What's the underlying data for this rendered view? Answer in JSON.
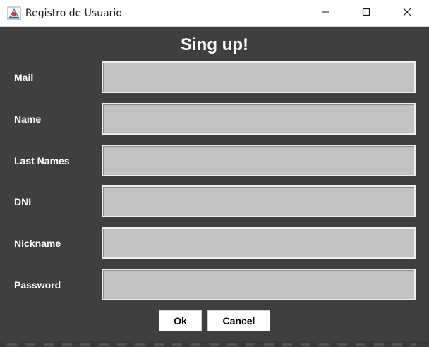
{
  "window": {
    "title": "Registro de Usuario",
    "icon": "java-app-icon",
    "controls": {
      "minimize_icon": "minimize-icon",
      "maximize_icon": "maximize-icon",
      "close_icon": "close-icon"
    }
  },
  "form": {
    "heading": "Sing up!",
    "fields": [
      {
        "label": "Mail",
        "value": ""
      },
      {
        "label": "Name",
        "value": ""
      },
      {
        "label": "Last Names",
        "value": ""
      },
      {
        "label": "DNI",
        "value": ""
      },
      {
        "label": "Nickname",
        "value": ""
      },
      {
        "label": "Password",
        "value": ""
      }
    ],
    "buttons": {
      "ok": "Ok",
      "cancel": "Cancel"
    }
  },
  "colors": {
    "background": "#3f3f3f",
    "field_bg": "#c2c2c2",
    "label_text": "#ffffff",
    "button_bg": "#ffffff"
  }
}
